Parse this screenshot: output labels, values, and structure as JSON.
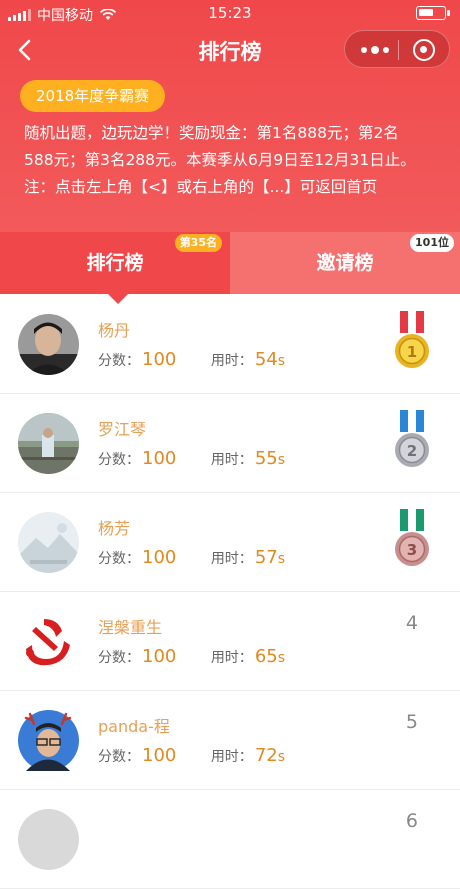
{
  "status_bar": {
    "carrier": "中国移动",
    "time": "15:23"
  },
  "nav": {
    "title": "排行榜"
  },
  "contest": {
    "title": "2018年度争霸赛",
    "intro_lines": [
      "随机出题，边玩边学！奖励现金：第1名888元；第2名",
      "588元；第3名288元。本赛季从6月9日至12月31日止。",
      "注：点击左上角【<】或右上角的【...】可返回首页"
    ]
  },
  "tabs": [
    {
      "label": "排行榜",
      "badge": "第35名"
    },
    {
      "label": "邀请榜",
      "badge": "101位"
    }
  ],
  "labels": {
    "score": "分数：",
    "time": "用时：",
    "seconds_unit": "s"
  },
  "leaderboard": [
    {
      "name": "杨丹",
      "score": "100",
      "time": "54",
      "rank": "1",
      "medal": "gold"
    },
    {
      "name": "罗江琴",
      "score": "100",
      "time": "55",
      "rank": "2",
      "medal": "silver"
    },
    {
      "name": "杨芳",
      "score": "100",
      "time": "57",
      "rank": "3",
      "medal": "bronze"
    },
    {
      "name": "涅槃重生",
      "score": "100",
      "time": "65",
      "rank": "4"
    },
    {
      "name": "panda-程",
      "score": "100",
      "time": "72",
      "rank": "5"
    },
    {
      "name": "",
      "score": "",
      "time": "",
      "rank": "6"
    }
  ],
  "colors": {
    "header_red": "#f0484a",
    "invite_tab": "#f57170",
    "badge_orange": "#ffb020",
    "name_text": "#e8a054",
    "value_text": "#e08a20"
  }
}
